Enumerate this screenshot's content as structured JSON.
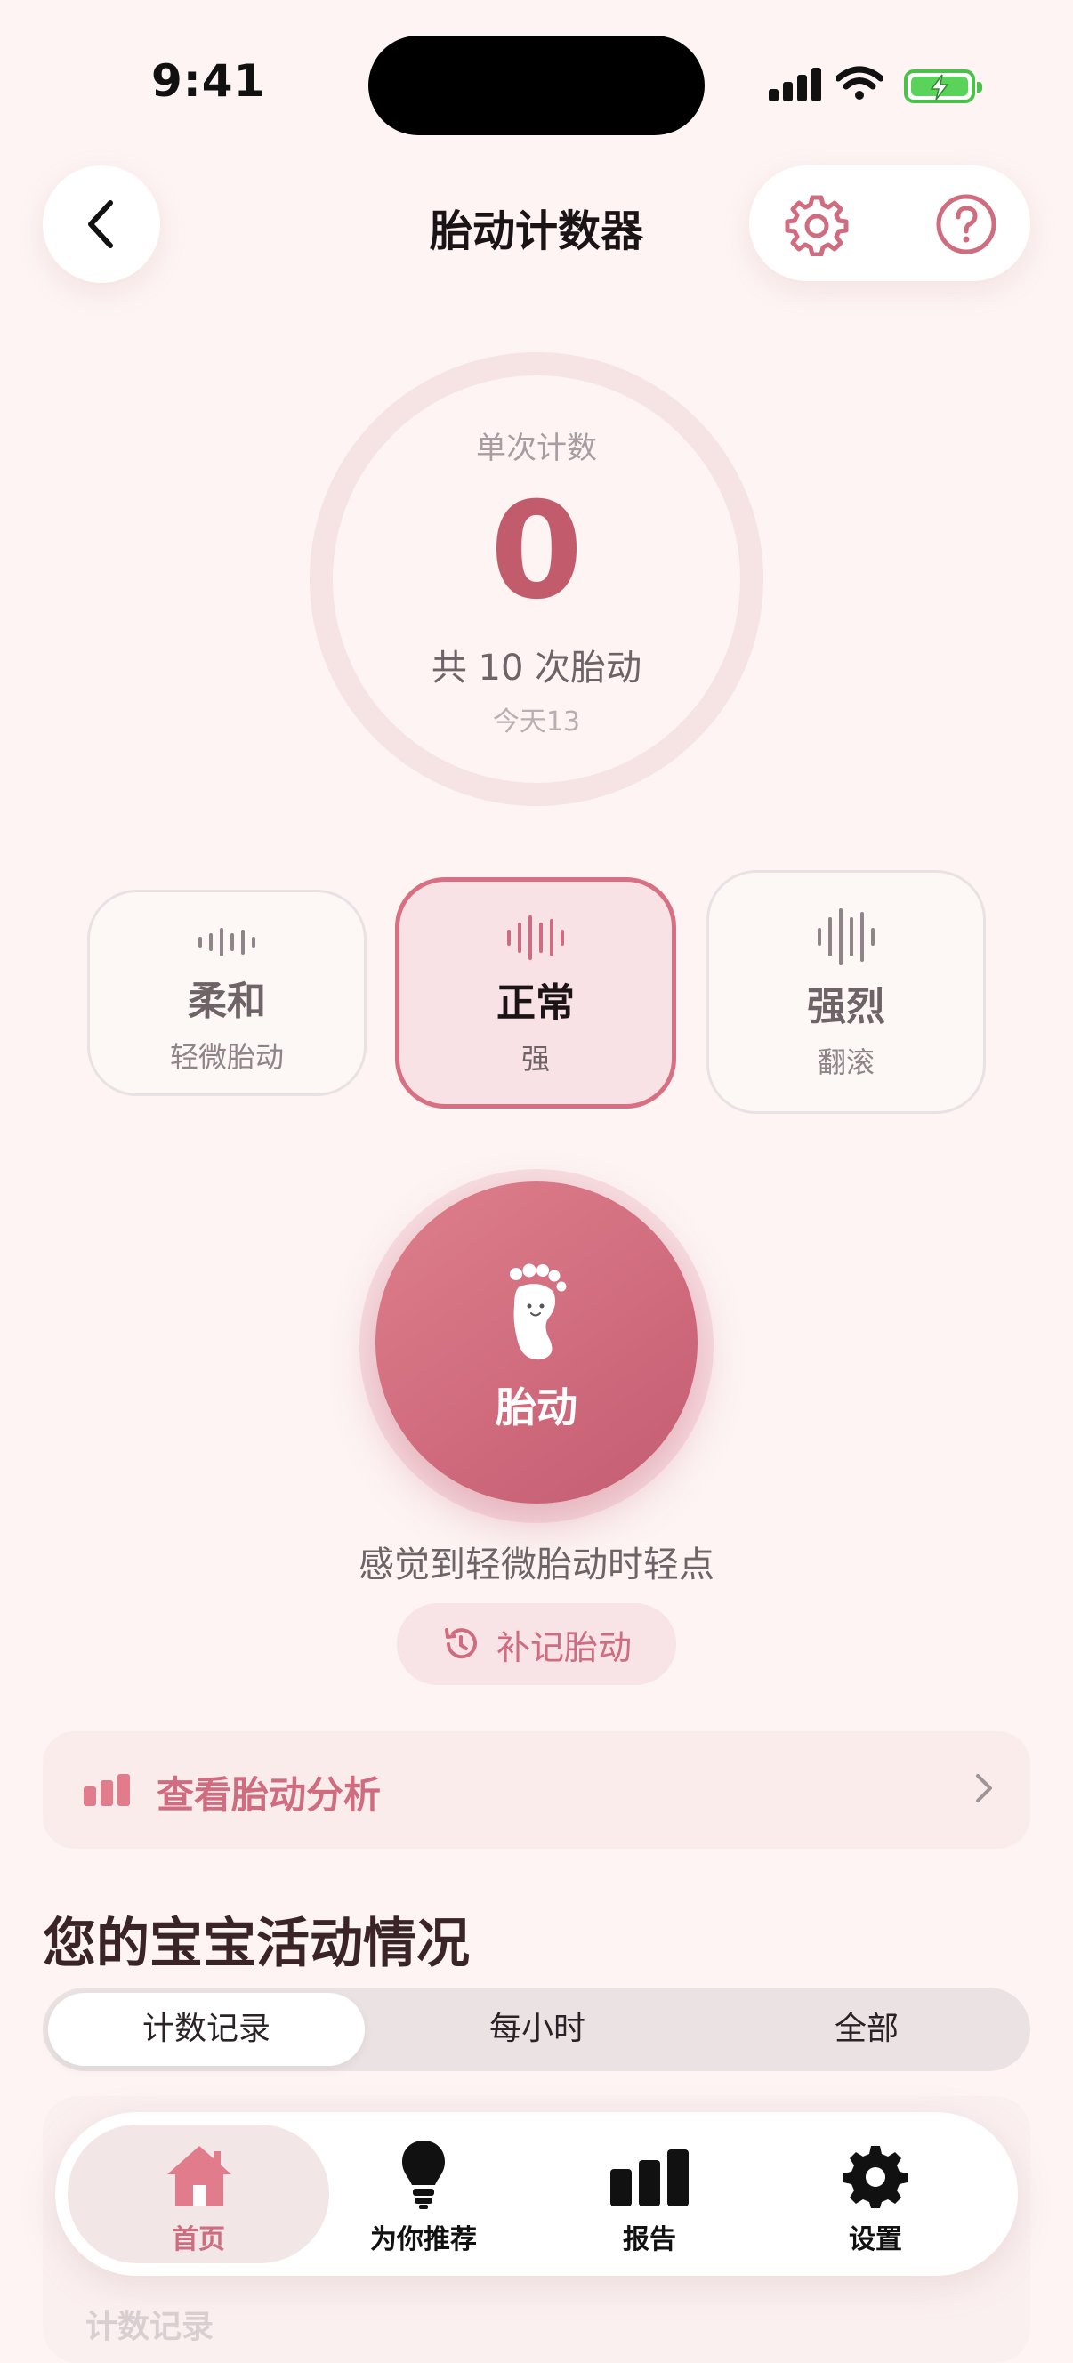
{
  "status_bar": {
    "time": "9:41"
  },
  "header": {
    "title": "胎动计数器"
  },
  "counter": {
    "label": "单次计数",
    "value": "0",
    "total": "共 10 次胎动",
    "today": "今天13"
  },
  "intensity": {
    "options": [
      {
        "title": "柔和",
        "subtitle": "轻微胎动"
      },
      {
        "title": "正常",
        "subtitle": "强"
      },
      {
        "title": "强烈",
        "subtitle": "翻滚"
      }
    ],
    "selected_index": 1
  },
  "tap_button": {
    "label": "胎动"
  },
  "hint": "感觉到轻微胎动时轻点",
  "backfill_button": {
    "label": "补记胎动"
  },
  "analysis_link": {
    "label": "查看胎动分析"
  },
  "activity": {
    "title": "您的宝宝活动情况",
    "tabs": [
      "计数记录",
      "每小时",
      "全部"
    ],
    "selected_tab": 0,
    "list_label": "计数记录"
  },
  "tab_bar": {
    "items": [
      {
        "label": "首页",
        "icon": "home-icon"
      },
      {
        "label": "为你推荐",
        "icon": "lightbulb-icon"
      },
      {
        "label": "报告",
        "icon": "bar-chart-icon"
      },
      {
        "label": "设置",
        "icon": "gear-icon"
      }
    ],
    "active_index": 0
  },
  "colors": {
    "accent": "#d06c7f",
    "accent_dark": "#c25c6d",
    "background": "#fdf4f3",
    "battery": "#5bd35b"
  }
}
